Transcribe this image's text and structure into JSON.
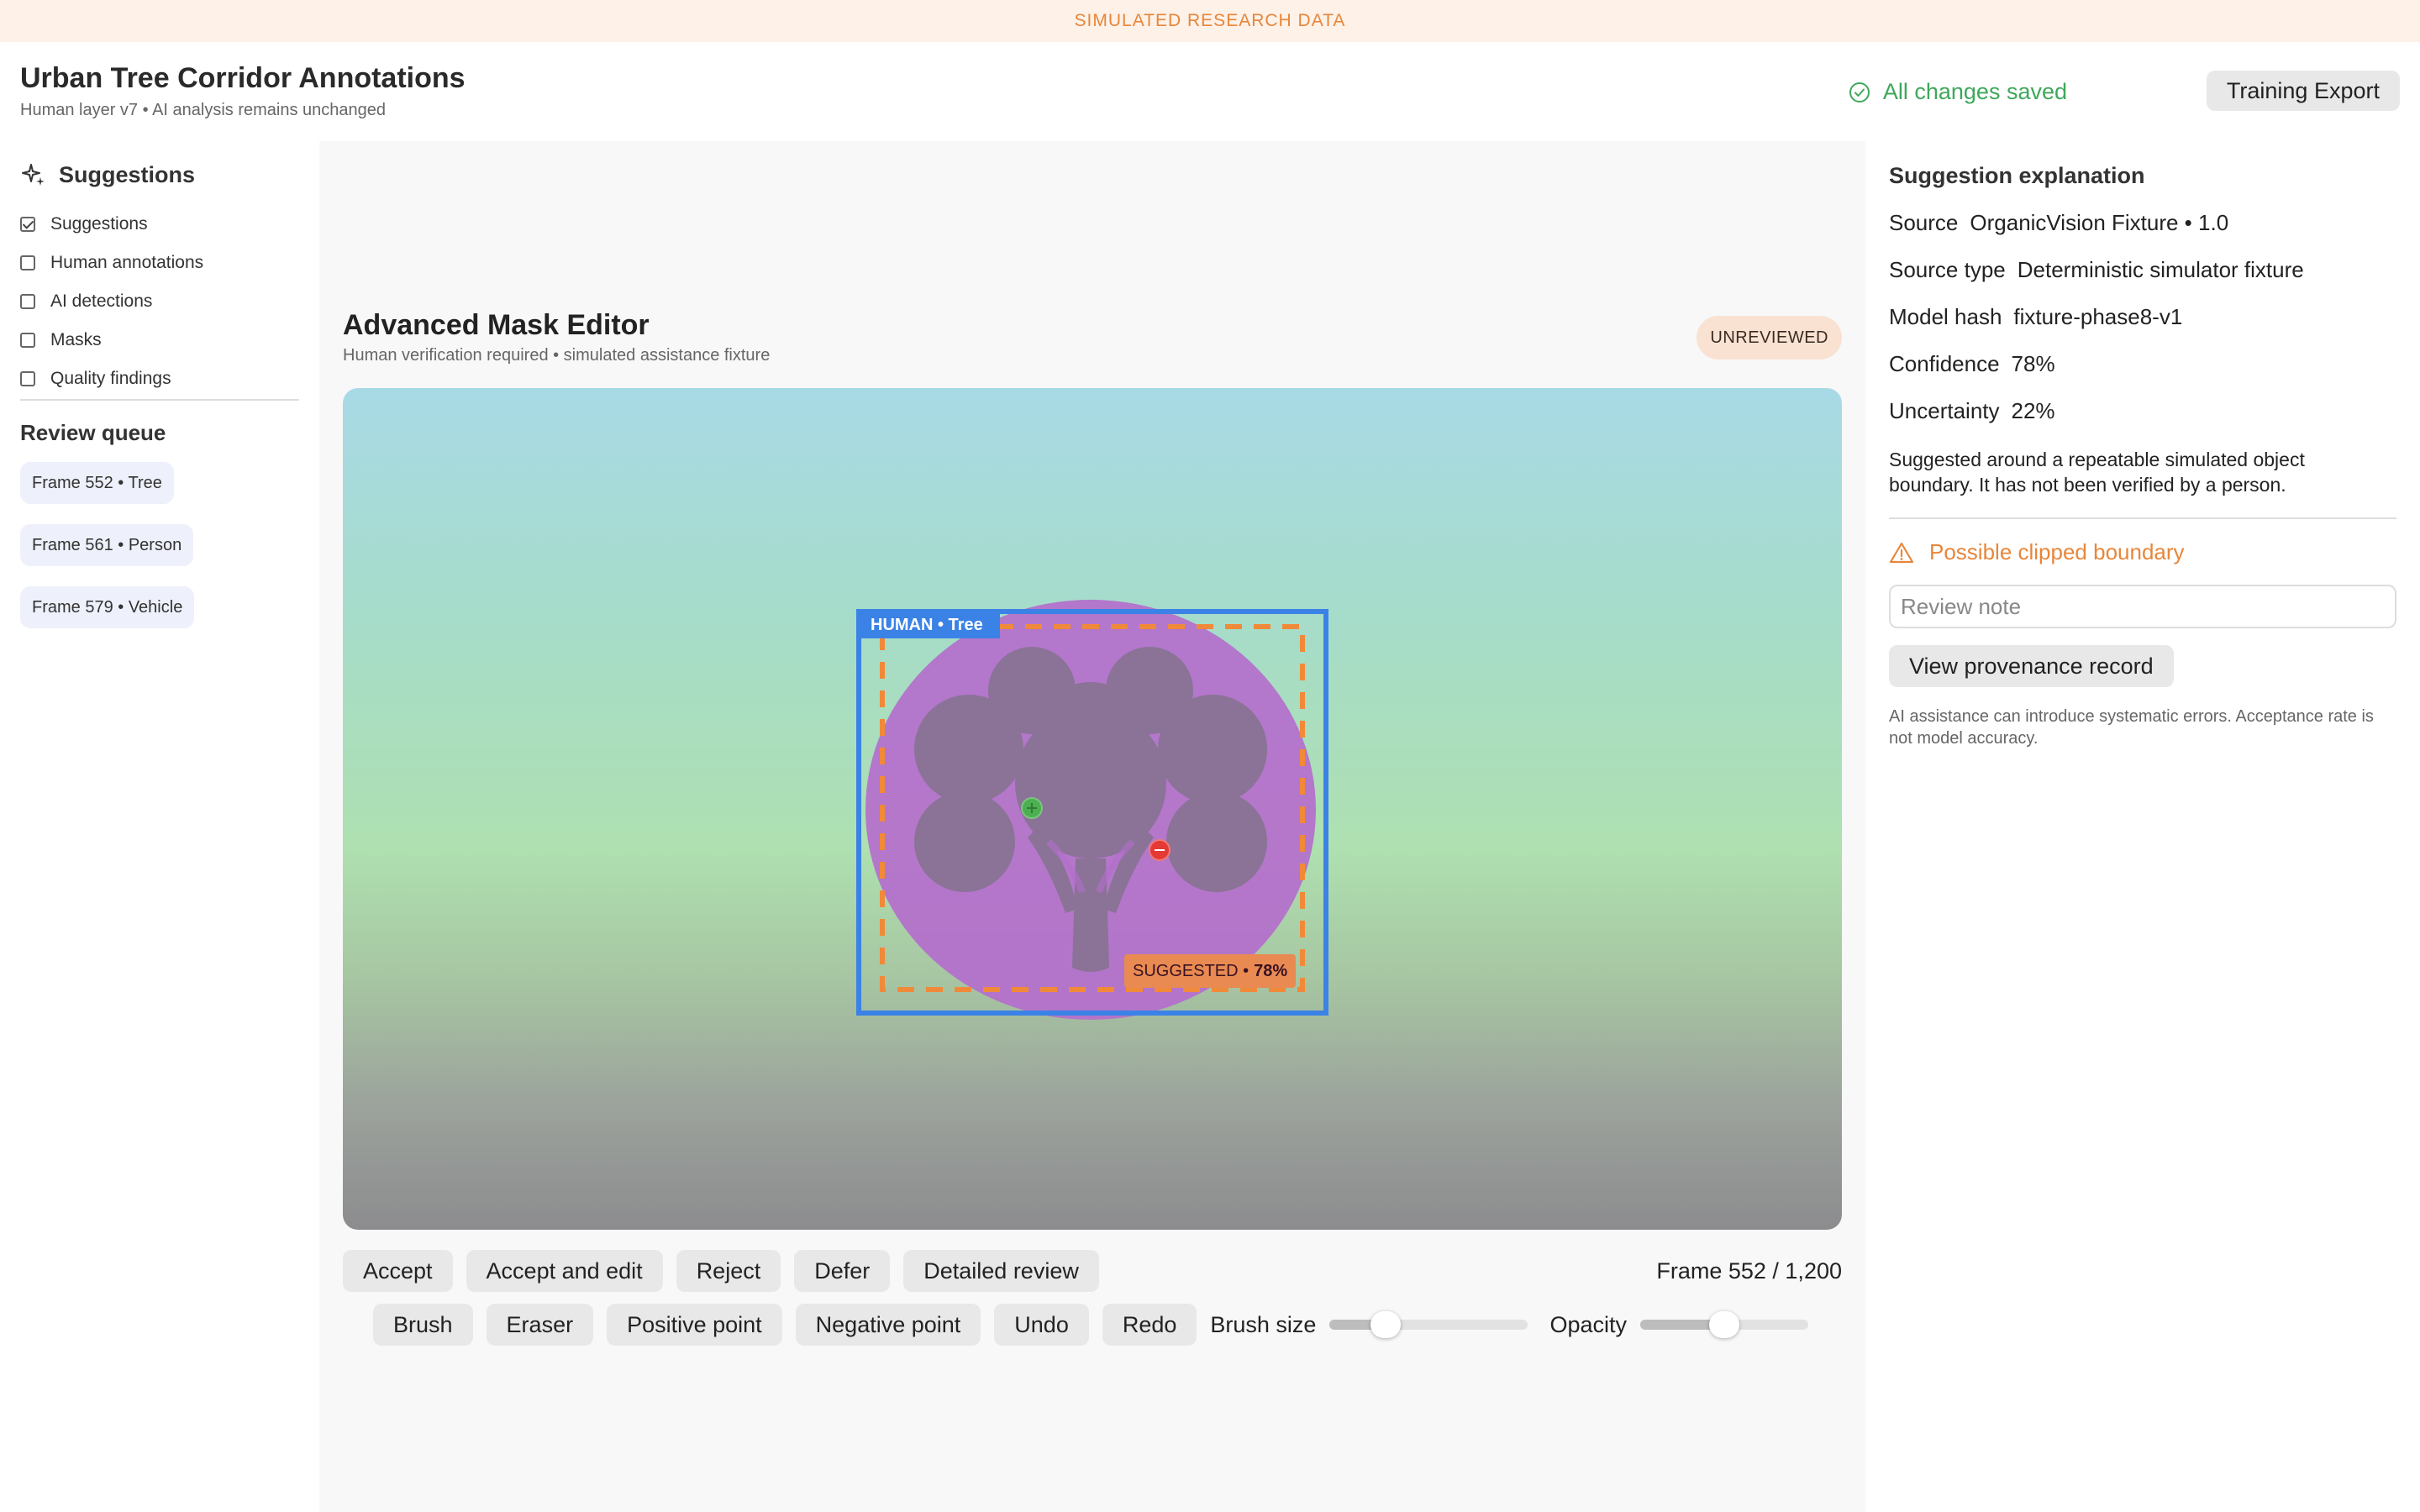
{
  "banner": {
    "text": "SIMULATED RESEARCH DATA"
  },
  "header": {
    "title": "Urban Tree Corridor Annotations",
    "subtitle": "Human layer v7 • AI analysis remains unchanged",
    "saved_status": "All changes saved",
    "export_label": "Training Export",
    "saved_color": "#3ea85a"
  },
  "sidebar": {
    "title": "Suggestions",
    "layers": [
      {
        "label": "Suggestions",
        "checked": true
      },
      {
        "label": "Human annotations",
        "checked": false
      },
      {
        "label": "AI detections",
        "checked": false
      },
      {
        "label": "Masks",
        "checked": false
      },
      {
        "label": "Quality findings",
        "checked": false
      }
    ],
    "queue_title": "Review queue",
    "queue": [
      {
        "label": "Frame 552 • Tree"
      },
      {
        "label": "Frame 561 • Person"
      },
      {
        "label": "Frame 579 • Vehicle"
      }
    ]
  },
  "editor": {
    "title": "Advanced Mask Editor",
    "subtitle": "Human verification required • simulated assistance fixture",
    "status": "UNREVIEWED",
    "human_label": "HUMAN • Tree",
    "suggested_label": "SUGGESTED •",
    "suggested_confidence": "78%",
    "actions": [
      "Accept",
      "Accept and edit",
      "Reject",
      "Defer",
      "Detailed review"
    ],
    "frame_indicator": "Frame 552 / 1,200",
    "tools": [
      "Brush",
      "Eraser",
      "Positive point",
      "Negative point",
      "Undo",
      "Redo"
    ],
    "brush_size_label": "Brush size",
    "brush_size_value": 0.28,
    "opacity_label": "Opacity",
    "opacity_value": 0.5,
    "colors": {
      "human_box": "#3b82e6",
      "suggested_box": "#f08a3a",
      "mask": "#b46ecc",
      "positive_point": "#4caf50",
      "negative_point": "#e53935"
    }
  },
  "explanation": {
    "title": "Suggestion explanation",
    "rows": [
      {
        "key": "Source",
        "value": "OrganicVision Fixture • 1.0"
      },
      {
        "key": "Source type",
        "value": "Deterministic simulator fixture"
      },
      {
        "key": "Model hash",
        "value": "fixture-phase8-v1"
      },
      {
        "key": "Confidence",
        "value": "78%"
      },
      {
        "key": "Uncertainty",
        "value": "22%"
      }
    ],
    "description": "Suggested around a repeatable simulated object boundary. It has not been verified by a person.",
    "warning": "Possible clipped boundary",
    "note_placeholder": "Review note",
    "provenance_label": "View provenance record",
    "disclaimer": "AI assistance can introduce systematic errors. Acceptance rate is not model accuracy."
  }
}
